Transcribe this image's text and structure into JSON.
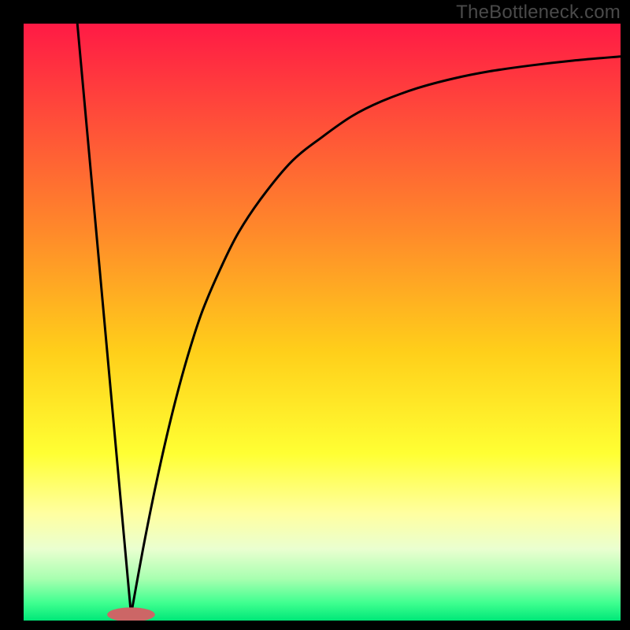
{
  "watermark": "TheBottleneck.com",
  "chart_data": {
    "type": "line",
    "title": "",
    "xlabel": "",
    "ylabel": "",
    "xlim": [
      0,
      100
    ],
    "ylim": [
      0,
      100
    ],
    "grid": false,
    "legend": false,
    "background_gradient": {
      "stops": [
        {
          "offset": 0.0,
          "color": "#ff1a45"
        },
        {
          "offset": 0.15,
          "color": "#ff4a3a"
        },
        {
          "offset": 0.35,
          "color": "#ff8a2a"
        },
        {
          "offset": 0.55,
          "color": "#ffcf1a"
        },
        {
          "offset": 0.72,
          "color": "#ffff33"
        },
        {
          "offset": 0.82,
          "color": "#ffffa0"
        },
        {
          "offset": 0.88,
          "color": "#eaffd0"
        },
        {
          "offset": 0.93,
          "color": "#a8ffb0"
        },
        {
          "offset": 0.97,
          "color": "#40ff90"
        },
        {
          "offset": 1.0,
          "color": "#00e878"
        }
      ]
    },
    "marker": {
      "x": 18,
      "y": 1,
      "rx": 4,
      "ry": 1.2,
      "color": "#cc6666"
    },
    "series": [
      {
        "name": "left-line",
        "x": [
          9,
          18
        ],
        "y": [
          100,
          1
        ]
      },
      {
        "name": "right-curve",
        "x": [
          18,
          20,
          22,
          24,
          26,
          28,
          30,
          33,
          36,
          40,
          45,
          50,
          55,
          60,
          66,
          72,
          78,
          85,
          92,
          100
        ],
        "y": [
          1,
          12,
          22,
          31,
          39,
          46,
          52,
          59,
          65,
          71,
          77,
          81,
          84.5,
          87,
          89.2,
          90.8,
          92,
          93,
          93.8,
          94.5
        ]
      }
    ]
  }
}
